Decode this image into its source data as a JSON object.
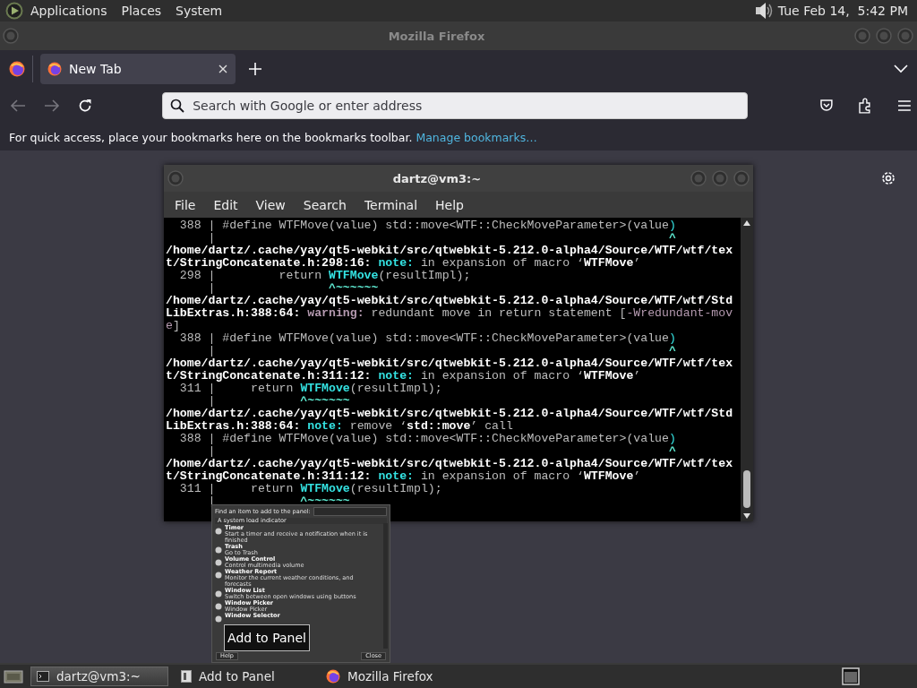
{
  "top_panel": {
    "menus": [
      "Applications",
      "Places",
      "System"
    ],
    "clock": "Tue Feb 14,  5:42 PM"
  },
  "browser": {
    "title": "Mozilla Firefox",
    "tabs": [
      {
        "label": "New Tab",
        "selected": true
      }
    ],
    "nav_buttons": [
      {
        "kind": "back",
        "disabled": true
      },
      {
        "kind": "forward",
        "disabled": true
      },
      {
        "kind": "reload",
        "disabled": false
      }
    ],
    "address": {
      "placeholder": "Search with Google or enter address"
    },
    "bookmarks_bar": {
      "message": "For quick access, place your bookmarks here on the bookmarks toolbar.",
      "link": "Manage bookmarks…"
    }
  },
  "terminal": {
    "title": "dartz@vm3:~",
    "menus": [
      "File",
      "Edit",
      "View",
      "Search",
      "Terminal",
      "Help"
    ],
    "lines": [
      [
        {
          "text": "  388 | #define WTFMove(value) std::move<WTF::CheckMoveParameter>(value",
          "kind": "plain"
        },
        {
          "text": ")",
          "kind": "cyan"
        }
      ],
      [
        {
          "text": "      |",
          "kind": "plain"
        },
        {
          "text": "                                                                ^",
          "kind": "caret"
        }
      ],
      [
        {
          "text": "/home/dartz/.cache/yay/qt5-webkit/src/qtwebkit-5.212.0-alpha4/Source/WTF/wtf/tex",
          "kind": "path"
        }
      ],
      [
        {
          "text": "t/StringConcatenate.h:298:16: ",
          "kind": "path"
        },
        {
          "text": "note:",
          "kind": "note"
        },
        {
          "text": " in expansion of macro ‘",
          "kind": "plain"
        },
        {
          "text": "WTFMove",
          "kind": "bold"
        },
        {
          "text": "’",
          "kind": "plain"
        }
      ],
      [
        {
          "text": "  298 |         return ",
          "kind": "plain"
        },
        {
          "text": "WTFMove",
          "kind": "hl"
        },
        {
          "text": "(resultImpl);",
          "kind": "plain"
        }
      ],
      [
        {
          "text": "      |",
          "kind": "plain"
        },
        {
          "text": "                ^~~~~~~",
          "kind": "caret"
        }
      ],
      [
        {
          "text": "/home/dartz/.cache/yay/qt5-webkit/src/qtwebkit-5.212.0-alpha4/Source/WTF/wtf/Std",
          "kind": "path"
        }
      ],
      [
        {
          "text": "LibExtras.h:388:64: ",
          "kind": "path"
        },
        {
          "text": "warning:",
          "kind": "warn"
        },
        {
          "text": " redundant move in return statement [",
          "kind": "plain"
        },
        {
          "text": "-Wredundant-mov",
          "kind": "flag"
        }
      ],
      [
        {
          "text": "e",
          "kind": "flag"
        },
        {
          "text": "]",
          "kind": "plain"
        }
      ],
      [
        {
          "text": "  388 | #define WTFMove(value) std::move<WTF::CheckMoveParameter>(value",
          "kind": "plain"
        },
        {
          "text": ")",
          "kind": "cyan"
        }
      ],
      [
        {
          "text": "      |",
          "kind": "plain"
        },
        {
          "text": "                                                                ^",
          "kind": "caret"
        }
      ],
      [
        {
          "text": "/home/dartz/.cache/yay/qt5-webkit/src/qtwebkit-5.212.0-alpha4/Source/WTF/wtf/tex",
          "kind": "path"
        }
      ],
      [
        {
          "text": "t/StringConcatenate.h:311:12: ",
          "kind": "path"
        },
        {
          "text": "note:",
          "kind": "note"
        },
        {
          "text": " in expansion of macro ‘",
          "kind": "plain"
        },
        {
          "text": "WTFMove",
          "kind": "bold"
        },
        {
          "text": "’",
          "kind": "plain"
        }
      ],
      [
        {
          "text": "  311 |     return ",
          "kind": "plain"
        },
        {
          "text": "WTFMove",
          "kind": "hl"
        },
        {
          "text": "(resultImpl);",
          "kind": "plain"
        }
      ],
      [
        {
          "text": "      |",
          "kind": "plain"
        },
        {
          "text": "            ^~~~~~~",
          "kind": "caret"
        }
      ],
      [
        {
          "text": "/home/dartz/.cache/yay/qt5-webkit/src/qtwebkit-5.212.0-alpha4/Source/WTF/wtf/Std",
          "kind": "path"
        }
      ],
      [
        {
          "text": "LibExtras.h:388:64: ",
          "kind": "path"
        },
        {
          "text": "note:",
          "kind": "note"
        },
        {
          "text": " remove ‘",
          "kind": "plain"
        },
        {
          "text": "std::move",
          "kind": "bold"
        },
        {
          "text": "’ call",
          "kind": "plain"
        }
      ],
      [
        {
          "text": "  388 | #define WTFMove(value) std::move<WTF::CheckMoveParameter>(value",
          "kind": "plain"
        },
        {
          "text": ")",
          "kind": "cyan"
        }
      ],
      [
        {
          "text": "      |",
          "kind": "plain"
        },
        {
          "text": "                                                                ^",
          "kind": "caret"
        }
      ],
      [
        {
          "text": "/home/dartz/.cache/yay/qt5-webkit/src/qtwebkit-5.212.0-alpha4/Source/WTF/wtf/tex",
          "kind": "path"
        }
      ],
      [
        {
          "text": "t/StringConcatenate.h:311:12: ",
          "kind": "path"
        },
        {
          "text": "note:",
          "kind": "note"
        },
        {
          "text": " in expansion of macro ‘",
          "kind": "plain"
        },
        {
          "text": "WTFMove",
          "kind": "bold"
        },
        {
          "text": "’",
          "kind": "plain"
        }
      ],
      [
        {
          "text": "  311 |     return ",
          "kind": "plain"
        },
        {
          "text": "WTFMove",
          "kind": "hl"
        },
        {
          "text": "(resultImpl);",
          "kind": "plain"
        }
      ],
      [
        {
          "text": "      |",
          "kind": "plain"
        },
        {
          "text": "            ^~~~~~~",
          "kind": "caret"
        }
      ]
    ]
  },
  "add_to_panel_preview": {
    "prompt": "Find an item to add to the panel:",
    "category": "A system load indicator",
    "items": [
      {
        "title": "Timer",
        "description": "Start a timer and receive a notification when it is finished"
      },
      {
        "title": "Trash",
        "description": "Go to Trash"
      },
      {
        "title": "Volume Control",
        "description": "Control multimedia volume"
      },
      {
        "title": "Weather Report",
        "description": "Monitor the current weather conditions, and forecasts"
      },
      {
        "title": "Window List",
        "description": "Switch between open windows using buttons"
      },
      {
        "title": "Window Picker",
        "description": "Window Picker"
      },
      {
        "title": "Window Selector"
      }
    ],
    "buttons": [
      "Help",
      "Close"
    ],
    "tooltip": "Add to Panel"
  },
  "taskbar": {
    "items": [
      {
        "kind": "terminal",
        "label": "dartz@vm3:~",
        "selected": true
      },
      {
        "kind": "window",
        "label": "Add to Panel",
        "selected": false
      },
      {
        "kind": "firefox",
        "label": "Mozilla Firefox",
        "selected": false
      }
    ]
  }
}
